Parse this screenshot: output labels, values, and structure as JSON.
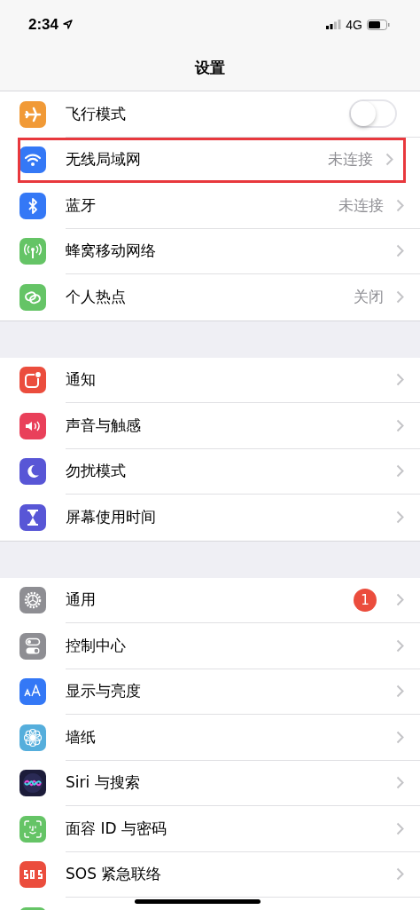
{
  "status_bar": {
    "time": "2:34",
    "network": "4G"
  },
  "title": "设置",
  "groups": [
    {
      "items": [
        {
          "label": "飞行模式",
          "kind": "toggle",
          "on": false,
          "highlighted": false
        },
        {
          "label": "无线局域网",
          "kind": "link",
          "value": "未连接",
          "highlighted": true
        },
        {
          "label": "蓝牙",
          "kind": "link",
          "value": "未连接",
          "highlighted": false
        },
        {
          "label": "蜂窝移动网络",
          "kind": "link",
          "highlighted": false
        },
        {
          "label": "个人热点",
          "kind": "link",
          "value": "关闭",
          "highlighted": false
        }
      ]
    },
    {
      "items": [
        {
          "label": "通知",
          "kind": "link",
          "highlighted": false
        },
        {
          "label": "声音与触感",
          "kind": "link",
          "highlighted": false
        },
        {
          "label": "勿扰模式",
          "kind": "link",
          "highlighted": false
        },
        {
          "label": "屏幕使用时间",
          "kind": "link",
          "highlighted": false
        }
      ]
    },
    {
      "items": [
        {
          "label": "通用",
          "kind": "link",
          "badge": "1",
          "highlighted": false
        },
        {
          "label": "控制中心",
          "kind": "link",
          "highlighted": false
        },
        {
          "label": "显示与亮度",
          "kind": "link",
          "highlighted": false
        },
        {
          "label": "墙纸",
          "kind": "link",
          "highlighted": false
        },
        {
          "label": "Siri 与搜索",
          "kind": "link",
          "highlighted": false
        },
        {
          "label": "面容 ID 与密码",
          "kind": "link",
          "highlighted": false
        },
        {
          "label": "SOS 紧急联络",
          "kind": "link",
          "highlighted": false
        },
        {
          "kind": "partial",
          "highlighted": false
        }
      ]
    }
  ]
}
